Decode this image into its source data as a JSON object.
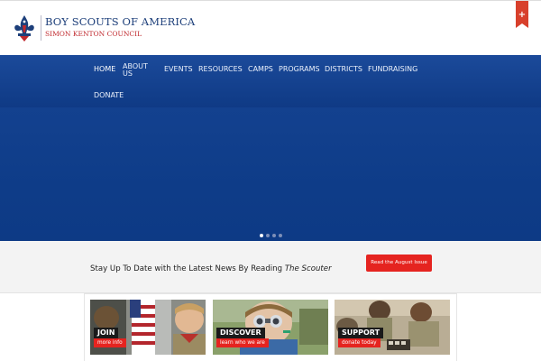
{
  "header": {
    "logo_title": "BOY SCOUTS OF AMERICA",
    "logo_subtitle": "SIMON KENTON COUNCIL",
    "ribbon_symbol": "+"
  },
  "nav": {
    "items": [
      {
        "label": "HOME",
        "active": true
      },
      {
        "label": "ABOUT US"
      },
      {
        "label": "EVENTS"
      },
      {
        "label": "RESOURCES"
      },
      {
        "label": "CAMPS"
      },
      {
        "label": "PROGRAMS"
      },
      {
        "label": "DISTRICTS"
      },
      {
        "label": "FUNDRAISING"
      },
      {
        "label": "DONATE"
      }
    ]
  },
  "hero": {
    "slide_count": 4,
    "active_slide": 1
  },
  "news": {
    "text": "Stay Up To Date with the Latest News By Reading ",
    "publication": "The Scouter",
    "button_label": "Read the August Issue"
  },
  "cards": [
    {
      "title": "JOIN",
      "link": "more info"
    },
    {
      "title": "DISCOVER",
      "link": "learn who we are"
    },
    {
      "title": "SUPPORT",
      "link": "donate today"
    }
  ],
  "colors": {
    "brand_blue": "#0f3a85",
    "accent_red": "#e52420",
    "logo_blue": "#1d3f7a",
    "logo_red": "#c0282d"
  }
}
